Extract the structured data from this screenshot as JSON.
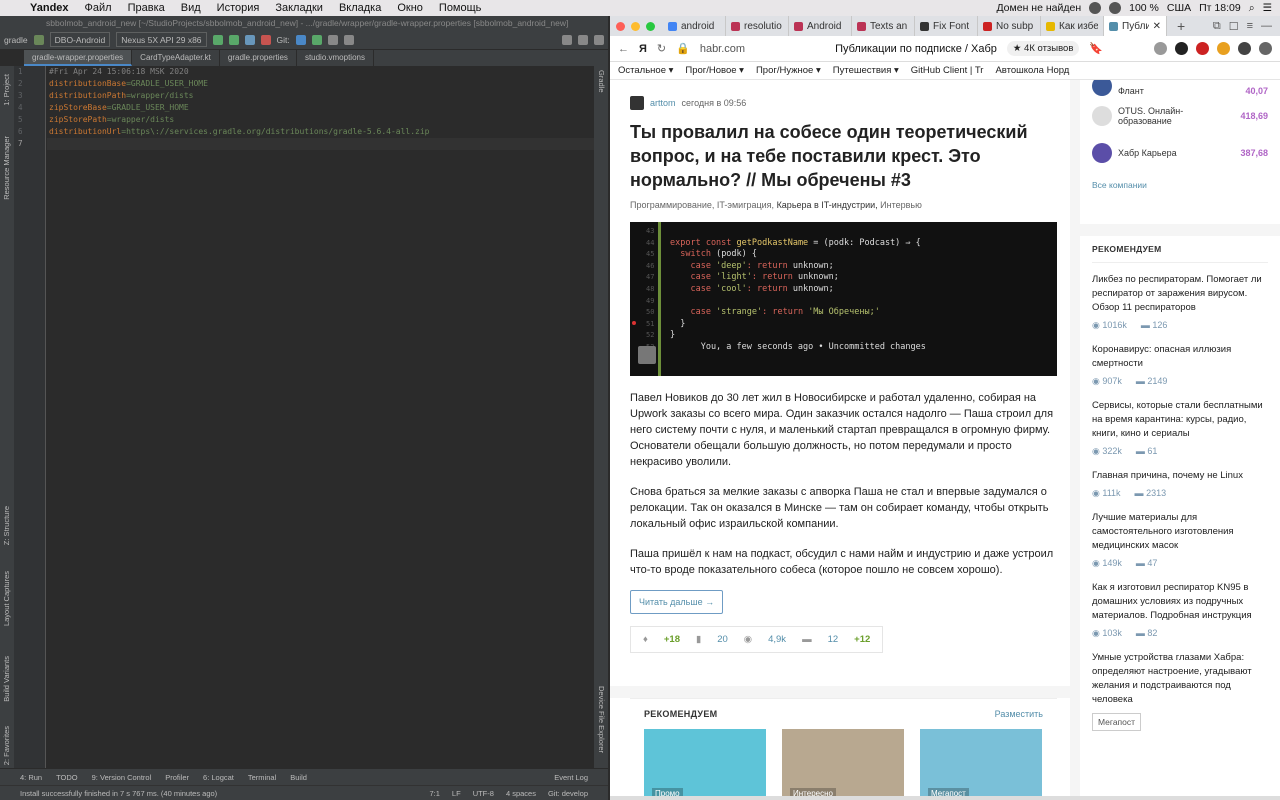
{
  "menubar": {
    "app": "Yandex",
    "items": [
      "Файл",
      "Правка",
      "Вид",
      "История",
      "Закладки",
      "Вкладка",
      "Окно",
      "Помощь"
    ],
    "right": {
      "domain_status": "Домен не найден",
      "battery": "100 %",
      "lang": "США",
      "clock": "Пт 18:09"
    }
  },
  "ide": {
    "title": "sbbolmob_android_new [~/StudioProjects/sbbolmob_android_new] - .../gradle/wrapper/gradle-wrapper.properties [sbbolmob_android_new]",
    "toolbar": {
      "project": "gradle",
      "config": "DBO-Android",
      "device": "Nexus 5X API 29 x86",
      "git": "Git:"
    },
    "tabs": [
      "gradle-wrapper.properties",
      "CardTypeAdapter.kt",
      "gradle.properties",
      "studio.vmoptions"
    ],
    "left_tools": [
      "1: Project",
      "Resource Manager",
      "Z: Structure",
      "Layout Captures",
      "Build Variants",
      "2: Favorites"
    ],
    "right_tools": [
      "Gradle",
      "Device File Explorer"
    ],
    "line_numbers": [
      "1",
      "2",
      "3",
      "4",
      "5",
      "6",
      "7"
    ],
    "code": {
      "l1": "#Fri Apr 24 15:06:18 MSK 2020",
      "l2k": "distributionBase",
      "l2v": "=GRADLE_USER_HOME",
      "l3k": "distributionPath",
      "l3v": "=wrapper/dists",
      "l4k": "zipStoreBase",
      "l4v": "=GRADLE_USER_HOME",
      "l5k": "zipStorePath",
      "l5v": "=wrapper/dists",
      "l6k": "distributionUrl",
      "l6v": "=https\\://services.gradle.org/distributions/gradle-5.6.4-all.zip"
    },
    "bottom_tools": [
      "4: Run",
      "TODO",
      "9: Version Control",
      "Profiler",
      "6: Logcat",
      "Terminal",
      "Build"
    ],
    "event_log": "Event Log",
    "status": {
      "message": "Install successfully finished in 7 s 767 ms. (40 minutes ago)",
      "pos": "7:1",
      "lf": "LF",
      "enc": "UTF-8",
      "indent": "4 spaces",
      "branch": "Git: develop"
    }
  },
  "browser": {
    "tabs": [
      {
        "label": "android",
        "color": "#4285f4"
      },
      {
        "label": "resolutio",
        "color": "#b35"
      },
      {
        "label": "Android",
        "color": "#b35"
      },
      {
        "label": "Texts an",
        "color": "#b35"
      },
      {
        "label": "Fix Font",
        "color": "#333"
      },
      {
        "label": "No subp",
        "color": "#c22"
      },
      {
        "label": "Как избе",
        "color": "#e6b800"
      },
      {
        "label": "Публи",
        "color": "#548eaa"
      }
    ],
    "url": "habr.com",
    "page_title": "Публикации по подписке / Хабр",
    "reviews": "★ 4К отзывов",
    "bookmarks": [
      "Остальное ▾",
      "Прог/Новое ▾",
      "Прог/Нужное ▾",
      "Путешествия ▾",
      "GitHub Client | Tr",
      "Автошкола Норд"
    ]
  },
  "article": {
    "author": "arttom",
    "time": "сегодня в 09:56",
    "title": "Ты провалил на собесе один теоретический вопрос, и на тебе поставили крест. Это нормально? // Мы обречены #3",
    "hubs": [
      "Программирование,",
      "IT-эмиграция,",
      "Карьера в IT-индустрии,",
      "Интервью"
    ],
    "code_lines": {
      "c1a": "export const ",
      "c1b": "getPodkastName",
      "c1c": " = (podk: Podcast) ⇒ {",
      "c2a": "  switch",
      "c2b": " (podk) {",
      "c3a": "    case ",
      "c3b": "'deep'",
      "c3c": ": return ",
      "c3d": "unknown;",
      "c4a": "    case ",
      "c4b": "'light'",
      "c4c": ": return ",
      "c4d": "unknown;",
      "c5a": "    case ",
      "c5b": "'cool'",
      "c5c": ": return ",
      "c5d": "unknown;",
      "c7a": "    case ",
      "c7b": "'strange'",
      "c7c": ": return ",
      "c7d": "'Мы Обречены;'",
      "c8": "  }",
      "c9": "}",
      "c10": "      You, a few seconds ago • Uncommitted changes"
    },
    "code_numbers": "43\n44\n45\n46\n47\n48\n49\n50\n51\n52\n53",
    "p1": "Павел Новиков до 30 лет жил в Новосибирске и работал удаленно, собирая на Upwork заказы со всего мира. Один заказчик остался надолго — Паша строил для него систему почти с нуля, и маленький стартап превращался в огромную фирму. Основатели обещали большую должность, но потом передумали и просто некрасиво уволили.",
    "p2": "Снова браться за мелкие заказы с апворка Паша не стал и впервые задумался о релокации. Так он оказался в Минске — там он собирает команду, чтобы открыть локальный офис израильской компании.",
    "p3": "Паша пришёл к нам на подкаст, обсудил с нами найм и индустрию и даже устроил что-то вроде показательного собеса (которое пошло не совсем хорошо).",
    "read_more": "Читать дальше →",
    "stats": {
      "votes": "+18",
      "bookmarks": "20",
      "views": "4,9k",
      "comments": "12",
      "new_comments": "+12"
    },
    "recommend": {
      "title": "РЕКОМЕНДУЕМ",
      "action": "Разместить",
      "cards": [
        "Промо",
        "Интересно",
        "Мегапост"
      ]
    }
  },
  "sidebar": {
    "companies": [
      {
        "name": "Флант",
        "rating": "40,07",
        "color": "#3b5998"
      },
      {
        "name": "OTUS. Онлайн-образование",
        "rating": "418,69",
        "color": "#444"
      },
      {
        "name": "Хабр Карьера",
        "rating": "387,68",
        "color": "#5b4ea8"
      }
    ],
    "all_companies": "Все компании",
    "recommend_title": "РЕКОМЕНДУЕМ",
    "posts": [
      {
        "title": "Ликбез по респираторам. Помогает ли респиратор от заражения вирусом. Обзор 11 респираторов",
        "views": "1016k",
        "comments": "126"
      },
      {
        "title": "Коронавирус: опасная иллюзия смертности",
        "views": "907k",
        "comments": "2149"
      },
      {
        "title": "Сервисы, которые стали бесплатными на время карантина: курсы, радио, книги, кино и сериалы",
        "views": "322k",
        "comments": "61"
      },
      {
        "title": "Главная причина, почему не Linux",
        "views": "111k",
        "comments": "2313"
      },
      {
        "title": "Лучшие материалы для самостоятельного изготовления медицинских масок",
        "views": "149k",
        "comments": "47"
      },
      {
        "title": "Как я изготовил респиратор KN95 в домашних условиях из подручных материалов. Подробная инструкция",
        "views": "103k",
        "comments": "82"
      },
      {
        "title": "Умные устройства глазами Хабра: определяют настроение, угадывают желания и подстраиваются под человека",
        "tag": "Мегапост"
      }
    ]
  }
}
